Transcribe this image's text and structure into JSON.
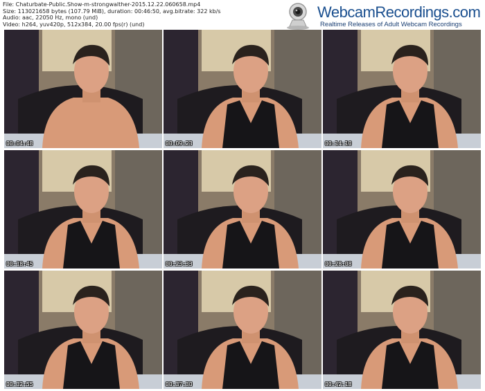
{
  "file_info": {
    "file": "File: Chaturbate-Public.Show-m-strongwalther-2015.12.22.060658.mp4",
    "size": "Size: 113021658 bytes (107.79 MiB), duration: 00:46:50, avg.bitrate: 322 kb/s",
    "audio": "Audio: aac, 22050 Hz, mono (und)",
    "video": "Video: h264, yuv420p, 512x384, 20.00 fps(r) (und)"
  },
  "logo": {
    "title": "WebcamRecordings.com",
    "subtitle": "Realtime Releases of Adult Webcam Recordings"
  },
  "colors": {
    "logo_blue": "#1a4f8f",
    "page_bg": "#ffffff"
  },
  "thumbnails": [
    {
      "timestamp": "00:04:48",
      "shirt": "none"
    },
    {
      "timestamp": "00:09:23",
      "shirt": "black tank top"
    },
    {
      "timestamp": "00:14:10",
      "shirt": "black tank top"
    },
    {
      "timestamp": "00:18:45",
      "shirt": "black tank top"
    },
    {
      "timestamp": "00:23:33",
      "shirt": "black tank top"
    },
    {
      "timestamp": "00:28:08",
      "shirt": "black tank top"
    },
    {
      "timestamp": "00:32:55",
      "shirt": "black tank top"
    },
    {
      "timestamp": "00:37:30",
      "shirt": "black tank top"
    },
    {
      "timestamp": "00:42:18",
      "shirt": "black tank top"
    }
  ]
}
